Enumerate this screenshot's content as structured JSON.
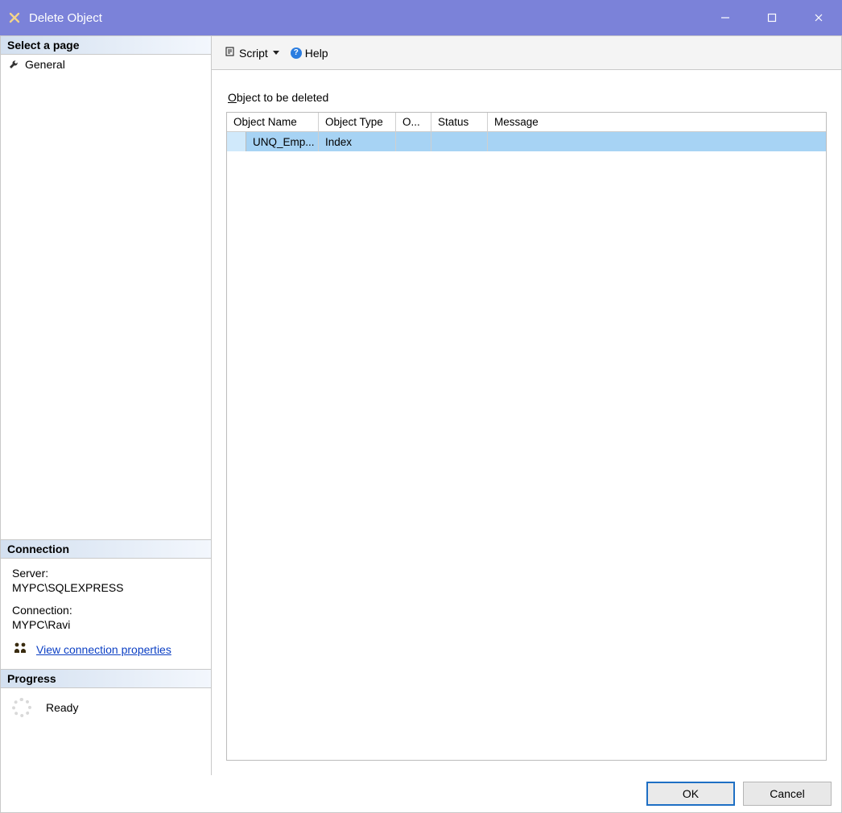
{
  "window": {
    "title": "Delete Object"
  },
  "sidebar": {
    "selectPage": {
      "header": "Select a page",
      "items": [
        {
          "label": "General"
        }
      ]
    },
    "connection": {
      "header": "Connection",
      "serverLabel": "Server:",
      "serverValue": "MYPC\\SQLEXPRESS",
      "connLabel": "Connection:",
      "connValue": "MYPC\\Ravi",
      "viewProps": "View connection properties"
    },
    "progress": {
      "header": "Progress",
      "status": "Ready"
    }
  },
  "toolbar": {
    "script": "Script",
    "help": "Help"
  },
  "main": {
    "sectionPrefix": "O",
    "sectionRest": "bject to be deleted",
    "columns": {
      "name": "Object Name",
      "type": "Object Type",
      "owner": "O...",
      "status": "Status",
      "message": "Message"
    },
    "rows": [
      {
        "name": "UNQ_Emp...",
        "type": "Index",
        "owner": "",
        "status": "",
        "message": ""
      }
    ]
  },
  "footer": {
    "ok": "OK",
    "cancel": "Cancel"
  }
}
